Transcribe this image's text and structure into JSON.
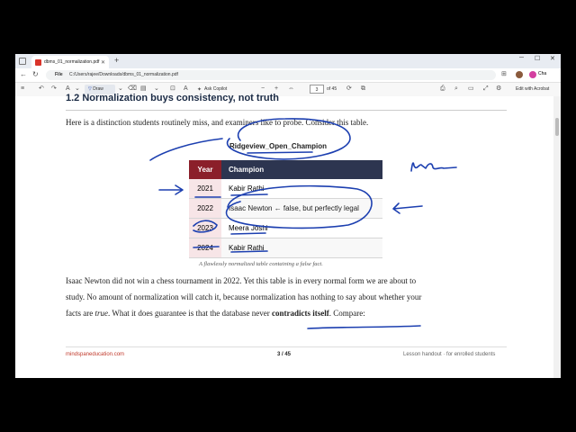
{
  "browser": {
    "tab_title": "dbms_01_normalization.pdf",
    "url_label": "File",
    "url": "C:/Users/rajee/Downloads/dbms_01_normalization.pdf",
    "copilot_label": "Cha"
  },
  "pdf_toolbar": {
    "draw_label": "Draw",
    "ask_copilot_label": "Ask Copilot",
    "page_current": "3",
    "page_total": "of 45",
    "edit_acrobat_label": "Edit with Acrobat"
  },
  "document": {
    "heading": "1.2  Normalization buys consistency, not truth",
    "intro": "Here is a distinction students routinely miss, and examiners like to probe. Consider this table.",
    "table_title": "Ridgeview_Open_Champion",
    "table": {
      "headers": [
        "Year",
        "Champion"
      ],
      "rows": [
        [
          "2021",
          "Kabir Rathi"
        ],
        [
          "2022",
          "Isaac Newton  ← false, but perfectly legal"
        ],
        [
          "2023",
          "Meera Joshi"
        ],
        [
          "2024",
          "Kabir Rathi"
        ]
      ]
    },
    "caption": "A flawlessly normalized table containing a false fact.",
    "para_line1": "Isaac Newton did not win a chess tournament in 2022. Yet this table is in every normal form we are about to",
    "para_line2": "study. No amount of normalization will catch it, because normalization has nothing to say about whether your",
    "para_line3_a": "facts are ",
    "para_line3_true": "true",
    "para_line3_b": ". What it does guarantee is that the database never ",
    "para_line3_bold": "contradicts itself",
    "para_line3_c": ". Compare:",
    "footer_left": "mindspaneducation.com",
    "footer_center": "3 / 45",
    "footer_right": "Lesson handout · for enrolled students"
  },
  "colors": {
    "ink": "#1c3fb0",
    "table_header": "#2d3550",
    "year_header": "#8b1f2a",
    "footer_link": "#c0392b"
  }
}
